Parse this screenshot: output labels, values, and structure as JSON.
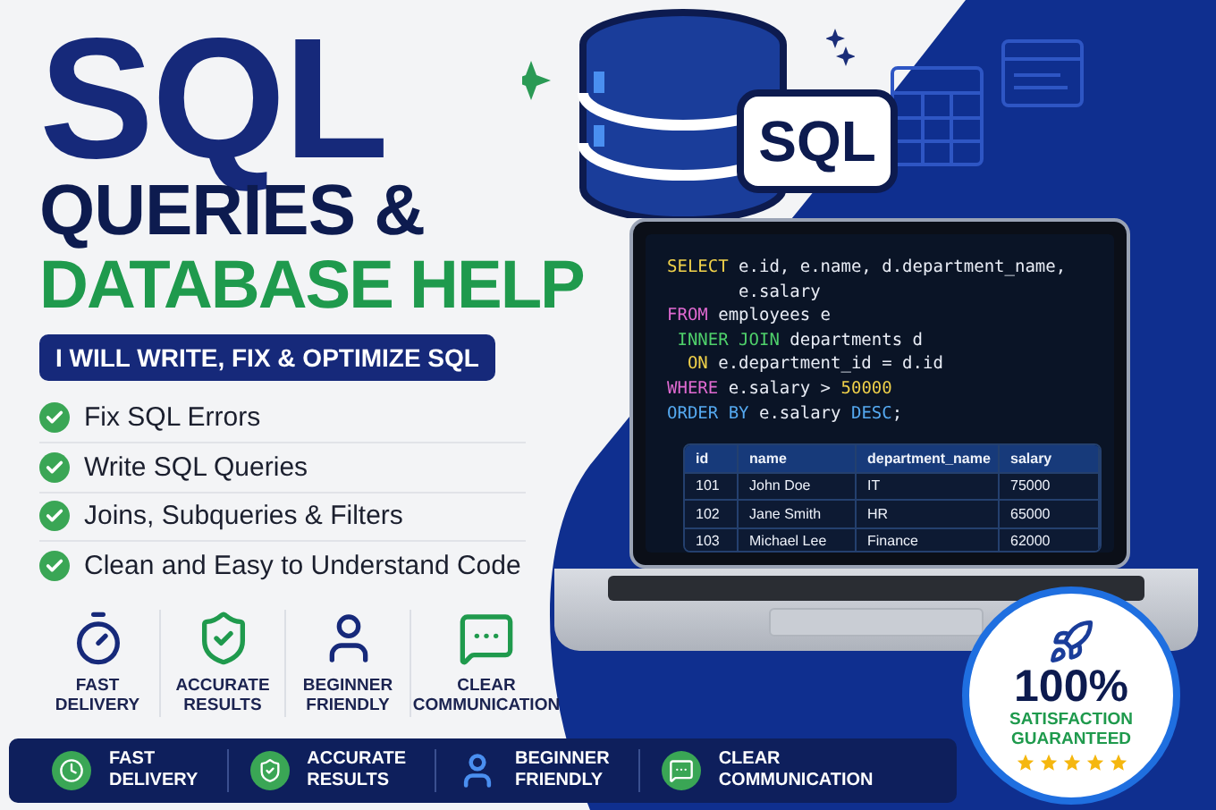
{
  "headline": {
    "title": "SQL",
    "line_2": "QUERIES &",
    "line_3": "DATABASE HELP"
  },
  "tagline": "I WILL WRITE, FIX & OPTIMIZE SQL",
  "sql_label": "SQL",
  "checklist": [
    {
      "text": "Fix SQL Errors"
    },
    {
      "text": "Write SQL Queries"
    },
    {
      "text": "Joins, Subqueries & Filters"
    },
    {
      "text": "Clean and Easy to Understand Code"
    }
  ],
  "features": [
    {
      "kind": "fast",
      "lines": [
        "FAST",
        "DELIVERY"
      ]
    },
    {
      "kind": "accurate",
      "lines": [
        "ACCURATE",
        "RESULTS"
      ]
    },
    {
      "kind": "beginner",
      "lines": [
        "BEGINNER",
        "FRIENDLY"
      ]
    },
    {
      "kind": "communication",
      "lines": [
        "CLEAR",
        "COMMUNICATION"
      ]
    }
  ],
  "code": [
    {
      "tokens": [
        {
          "kind": "select",
          "text": "SELECT"
        },
        {
          "kind": "plain",
          "text": " e.id, e.name, d.department_name,"
        }
      ]
    },
    {
      "tokens": [
        {
          "kind": "plain",
          "text": "       e.salary"
        }
      ]
    },
    {
      "tokens": [
        {
          "kind": "from",
          "text": "FROM"
        },
        {
          "kind": "plain",
          "text": " employees e"
        }
      ]
    },
    {
      "tokens": [
        {
          "kind": "join",
          "text": " INNER JOIN"
        },
        {
          "kind": "plain",
          "text": " departments d"
        }
      ]
    },
    {
      "tokens": [
        {
          "kind": "select",
          "text": "  ON"
        },
        {
          "kind": "plain",
          "text": " e.department_id = d.id"
        }
      ]
    },
    {
      "tokens": [
        {
          "kind": "from",
          "text": "WHERE"
        },
        {
          "kind": "plain",
          "text": " e.salary > "
        },
        {
          "kind": "number",
          "text": "50000"
        }
      ]
    },
    {
      "tokens": [
        {
          "kind": "order",
          "text": "ORDER BY"
        },
        {
          "kind": "plain",
          "text": " e.salary "
        },
        {
          "kind": "order",
          "text": "DESC"
        },
        {
          "kind": "plain",
          "text": ";"
        }
      ]
    }
  ],
  "table": {
    "columns": [
      "id",
      "name",
      "department_name",
      "salary"
    ],
    "rows": [
      [
        "101",
        "John Doe",
        "IT",
        "75000"
      ],
      [
        "102",
        "Jane Smith",
        "HR",
        "65000"
      ],
      [
        "103",
        "Michael Lee",
        "Finance",
        "62000"
      ]
    ]
  },
  "bottom_bar": [
    {
      "kind": "fast",
      "lines": [
        "FAST",
        "DELIVERY"
      ]
    },
    {
      "kind": "accurate",
      "lines": [
        "ACCURATE",
        "RESULTS"
      ]
    },
    {
      "kind": "beginner",
      "lines": [
        "BEGINNER",
        "FRIENDLY"
      ]
    },
    {
      "kind": "communication",
      "lines": [
        "CLEAR",
        "COMMUNICATION"
      ]
    }
  ],
  "guarantee": {
    "value": "100%",
    "line_1": "SATISFACTION",
    "line_2": "GUARANTEED",
    "stars": 5
  }
}
